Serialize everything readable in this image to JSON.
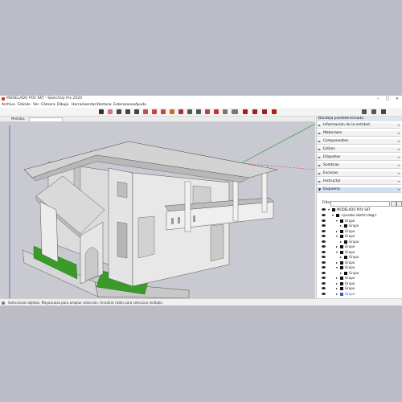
{
  "window": {
    "title": "MODELADO POV SKT - SketchUp Pro 2020",
    "controls": [
      "minimize-icon",
      "maximize-icon",
      "close-icon"
    ]
  },
  "menu": [
    "Archivo",
    "Edición",
    "Ver",
    "Cámara",
    "Dibujo",
    "Herramientas",
    "Ventana",
    "Extensiones",
    "Ayuda"
  ],
  "toolbar": {
    "icons": [
      "select-icon",
      "eraser-icon",
      "line-icon",
      "arc-icon",
      "rectangle-icon",
      "push-pull-icon",
      "move-icon",
      "rotate-icon",
      "scale-icon",
      "offset-icon",
      "tape-measure-icon",
      "text-icon",
      "paint-bucket-icon",
      "orbit-icon",
      "pan-icon",
      "zoom-icon",
      "zoom-extents-icon",
      "3d-warehouse-icon",
      "extension-warehouse-icon",
      "layout-icon",
      "ruby-icon",
      "add-location-icon",
      "geo-icon",
      "settings-icon"
    ]
  },
  "measurements_label": "Medidas",
  "tray": {
    "title": "Bandeja predeterminada",
    "panels": [
      {
        "label": "Información de la entidad",
        "open": false
      },
      {
        "label": "Materiales",
        "open": false
      },
      {
        "label": "Componentes",
        "open": false
      },
      {
        "label": "Estilos",
        "open": false
      },
      {
        "label": "Etiquetas",
        "open": false
      },
      {
        "label": "Sombras",
        "open": false
      },
      {
        "label": "Escenas",
        "open": false
      },
      {
        "label": "Instructor",
        "open": false
      },
      {
        "label": "Esquema",
        "open": true
      }
    ],
    "filter_label": "Filtro:",
    "filter_value": "",
    "outliner": {
      "root": "MODELADO POV SKT",
      "items": [
        {
          "label": "<prueba sketch.dwg>",
          "depth": 1,
          "expanded": true
        },
        {
          "label": "Grupo",
          "depth": 2,
          "expanded": true
        },
        {
          "label": "Grupo",
          "depth": 3,
          "expanded": false
        },
        {
          "label": "Grupo",
          "depth": 2,
          "expanded": false
        },
        {
          "label": "Grupo",
          "depth": 2,
          "expanded": true
        },
        {
          "label": "Grupo",
          "depth": 3,
          "expanded": false
        },
        {
          "label": "Grupo",
          "depth": 2,
          "expanded": false
        },
        {
          "label": "Grupo",
          "depth": 2,
          "expanded": true
        },
        {
          "label": "Grupo",
          "depth": 3,
          "expanded": false
        },
        {
          "label": "Grupo",
          "depth": 2,
          "expanded": false
        },
        {
          "label": "Grupo",
          "depth": 2,
          "expanded": true
        },
        {
          "label": "Grupo",
          "depth": 3,
          "expanded": false
        },
        {
          "label": "Grupo",
          "depth": 2,
          "expanded": false
        },
        {
          "label": "Grupo",
          "depth": 2,
          "expanded": false
        },
        {
          "label": "Grupo",
          "depth": 2,
          "expanded": false
        },
        {
          "label": "Grupo",
          "depth": 2,
          "expanded": false,
          "selected": true
        }
      ]
    }
  },
  "status": "Seleccionar objetos. Mayúsculas para ampliar selección. Arrastrar ratón para seleccion múltiple.",
  "colors": {
    "accent": "#2a64c8",
    "grass": "#3a9a2a",
    "sky": "#c9c9d1",
    "wall": "#e6e6e6"
  }
}
